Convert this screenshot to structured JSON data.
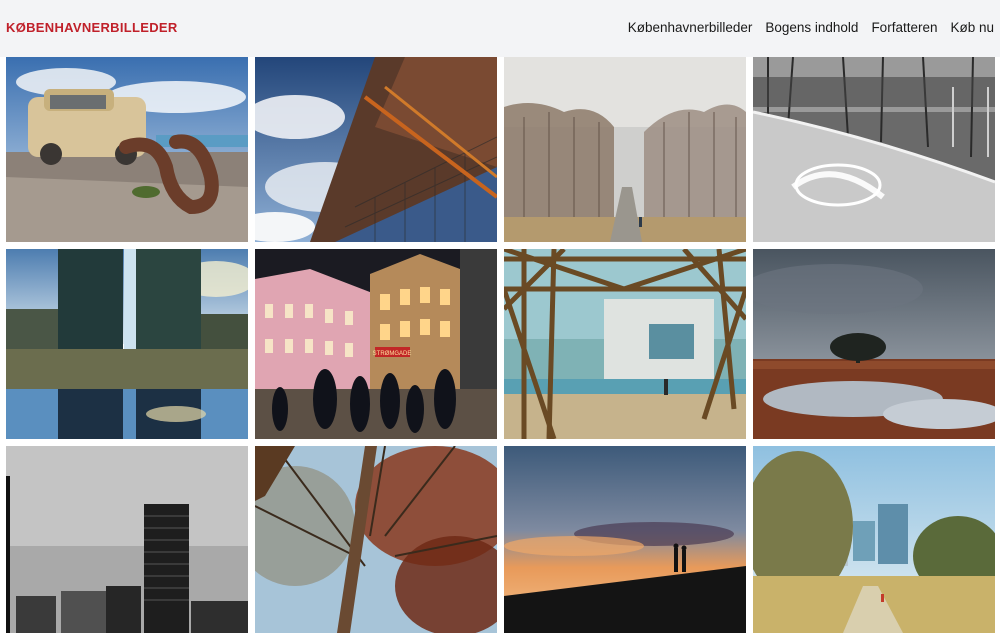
{
  "brand": "KØBENHAVNERBILLEDER",
  "nav": {
    "items": [
      {
        "label": "Københavnerbilleder"
      },
      {
        "label": "Bogens indhold"
      },
      {
        "label": "Forfatteren"
      },
      {
        "label": "Køb nu"
      }
    ]
  },
  "photos": [
    {
      "subject": "rusty-car-and-sculpture"
    },
    {
      "subject": "industrial-building-and-clouds"
    },
    {
      "subject": "foggy-forest-path"
    },
    {
      "subject": "skate-ramp-graffiti"
    },
    {
      "subject": "tower-reflection-in-puddle"
    },
    {
      "subject": "night-street-with-people"
    },
    {
      "subject": "steel-lattice-waterfront"
    },
    {
      "subject": "lone-tree-on-wetland"
    },
    {
      "subject": "high-rise-black-and-white"
    },
    {
      "subject": "autumn-trees-looking-up"
    },
    {
      "subject": "sunset-silhouettes-on-hill"
    },
    {
      "subject": "meadow-path-and-towers"
    }
  ],
  "signs": {
    "stromgade": "STRØMGADE"
  }
}
